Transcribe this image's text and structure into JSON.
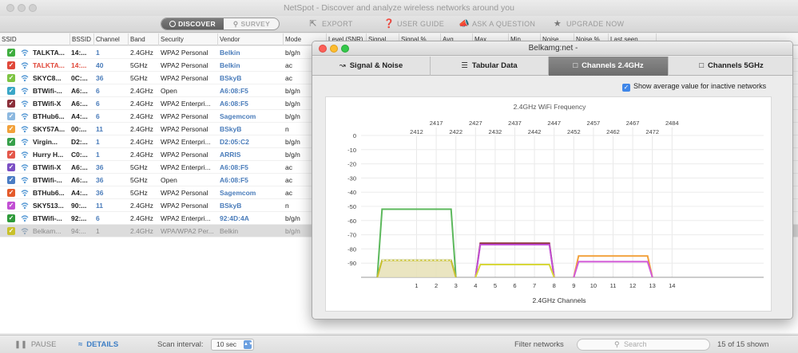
{
  "window": {
    "title": "NetSpot - Discover and analyze wireless networks around you"
  },
  "toolbar": {
    "discover": "DISCOVER",
    "survey": "SURVEY",
    "export": "EXPORT",
    "user_guide": "USER GUIDE",
    "ask_question": "ASK A QUESTION",
    "upgrade": "UPGRADE NOW"
  },
  "table": {
    "columns": [
      "SSID",
      "BSSID",
      "Channel",
      "Band",
      "Security",
      "Vendor",
      "Mode",
      "Level (SNR)",
      "Signal",
      "Signal %",
      "Avg",
      "Max",
      "Min",
      "Noise",
      "Noise %",
      "Last seen"
    ],
    "rows": [
      {
        "color": "#3fae3f",
        "ssid": "TALKTA...",
        "bssid": "14:...",
        "channel": "1",
        "band": "2.4GHz",
        "security": "WPA2 Personal",
        "vendor": "Belkin",
        "mode": "b/g/n"
      },
      {
        "color": "#e0483a",
        "ssid": "TALKTA...",
        "bssid": "14:...",
        "channel": "40",
        "band": "5GHz",
        "security": "WPA2 Personal",
        "vendor": "Belkin",
        "mode": "ac",
        "ssid_color": "#e0483a"
      },
      {
        "color": "#7dc443",
        "ssid": "SKYC8...",
        "bssid": "0C:...",
        "channel": "36",
        "band": "5GHz",
        "security": "WPA2 Personal",
        "vendor": "BSkyB",
        "mode": "ac"
      },
      {
        "color": "#3aa6c7",
        "ssid": "BTWifi-...",
        "bssid": "A6:...",
        "channel": "6",
        "band": "2.4GHz",
        "security": "Open",
        "vendor": "A6:08:F5",
        "mode": "b/g/n"
      },
      {
        "color": "#8b2f3a",
        "ssid": "BTWifi-X",
        "bssid": "A6:...",
        "channel": "6",
        "band": "2.4GHz",
        "security": "WPA2 Enterpri...",
        "vendor": "A6:08:F5",
        "mode": "b/g/n"
      },
      {
        "color": "#8cb8e0",
        "ssid": "BTHub6...",
        "bssid": "A4:...",
        "channel": "6",
        "band": "2.4GHz",
        "security": "WPA2 Personal",
        "vendor": "Sagemcom",
        "mode": "b/g/n"
      },
      {
        "color": "#f2a13a",
        "ssid": "SKY57A...",
        "bssid": "00:...",
        "channel": "11",
        "band": "2.4GHz",
        "security": "WPA2 Personal",
        "vendor": "BSkyB",
        "mode": "n"
      },
      {
        "color": "#37a04a",
        "ssid": "Virgin...",
        "bssid": "D2:...",
        "channel": "1",
        "band": "2.4GHz",
        "security": "WPA2 Enterpri...",
        "vendor": "D2:05:C2",
        "mode": "b/g/n"
      },
      {
        "color": "#e4574a",
        "ssid": "Hurry H...",
        "bssid": "C0:...",
        "channel": "1",
        "band": "2.4GHz",
        "security": "WPA2 Personal",
        "vendor": "ARRIS",
        "mode": "b/g/n"
      },
      {
        "color": "#7b4fc4",
        "ssid": "BTWifi-X",
        "bssid": "A6:...",
        "channel": "36",
        "band": "5GHz",
        "security": "WPA2 Enterpri...",
        "vendor": "A6:08:F5",
        "mode": "ac"
      },
      {
        "color": "#4a7cc4",
        "ssid": "BTWifi-...",
        "bssid": "A6:...",
        "channel": "36",
        "band": "5GHz",
        "security": "Open",
        "vendor": "A6:08:F5",
        "mode": "ac"
      },
      {
        "color": "#e45a2a",
        "ssid": "BTHub6...",
        "bssid": "A4:...",
        "channel": "36",
        "band": "5GHz",
        "security": "WPA2 Personal",
        "vendor": "Sagemcom",
        "mode": "ac"
      },
      {
        "color": "#c24fd4",
        "ssid": "SKY513...",
        "bssid": "90:...",
        "channel": "11",
        "band": "2.4GHz",
        "security": "WPA2 Personal",
        "vendor": "BSkyB",
        "mode": "n"
      },
      {
        "color": "#2e9a3a",
        "ssid": "BTWifi-...",
        "bssid": "92:...",
        "channel": "6",
        "band": "2.4GHz",
        "security": "WPA2 Enterpri...",
        "vendor": "92:4D:4A",
        "mode": "b/g/n"
      },
      {
        "color": "#c9c12a",
        "ssid": "Belkam...",
        "bssid": "94:...",
        "channel": "1",
        "band": "2.4GHz",
        "security": "WPA/WPA2 Per...",
        "vendor": "Belkin",
        "mode": "b/g/n",
        "selected": true
      }
    ]
  },
  "bottombar": {
    "pause": "PAUSE",
    "details": "DETAILS",
    "scan_interval_label": "Scan interval:",
    "scan_interval_value": "10 sec",
    "filter_label": "Filter networks",
    "search_placeholder": "Search",
    "count": "15 of 15 shown"
  },
  "dialog": {
    "title": "Belkamg:net -",
    "tabs": [
      "Signal & Noise",
      "Tabular Data",
      "Channels 2.4GHz",
      "Channels 5GHz"
    ],
    "active_tab": 2,
    "show_avg_label": "Show average value for inactive networks",
    "show_avg_checked": true
  },
  "chart_data": {
    "type": "area",
    "title": "2.4GHz WiFi Frequency",
    "xlabel": "2.4GHz Channels",
    "x_ticks": [
      1,
      2,
      3,
      4,
      5,
      6,
      7,
      8,
      9,
      10,
      11,
      12,
      13,
      14
    ],
    "freq_ticks": [
      {
        "channel": 1,
        "freq": "2412"
      },
      {
        "channel": 2,
        "freq": "2417"
      },
      {
        "channel": 3,
        "freq": "2422"
      },
      {
        "channel": 4,
        "freq": "2427"
      },
      {
        "channel": 5,
        "freq": "2432"
      },
      {
        "channel": 6,
        "freq": "2437"
      },
      {
        "channel": 7,
        "freq": "2442"
      },
      {
        "channel": 8,
        "freq": "2447"
      },
      {
        "channel": 9,
        "freq": "2452"
      },
      {
        "channel": 10,
        "freq": "2457"
      },
      {
        "channel": 11,
        "freq": "2462"
      },
      {
        "channel": 12,
        "freq": "2467"
      },
      {
        "channel": 13,
        "freq": "2472"
      },
      {
        "channel": 14,
        "freq": "2484"
      }
    ],
    "y_ticks": [
      0,
      -10,
      -20,
      -30,
      -40,
      -50,
      -60,
      -70,
      -80,
      -90
    ],
    "ylim": [
      -100,
      0
    ],
    "series": [
      {
        "center": 1,
        "level": -52,
        "color": "#5cb85c"
      },
      {
        "center": 1,
        "level": -88,
        "color": "#8e7bd4"
      },
      {
        "center": 1,
        "level": -88,
        "color": "#6a9cd8"
      },
      {
        "center": 1,
        "level": -88,
        "color": "#c9c12a",
        "fill": "#e6e0b6",
        "selected": true
      },
      {
        "center": 6,
        "level": -76,
        "color": "#8b2f3a"
      },
      {
        "center": 6,
        "level": -77,
        "color": "#c24fd4"
      },
      {
        "center": 6,
        "level": -91,
        "color": "#d8d83a"
      },
      {
        "center": 11,
        "level": -85,
        "color": "#f2a13a"
      },
      {
        "center": 11,
        "level": -89,
        "color": "#d25ad8"
      }
    ]
  }
}
